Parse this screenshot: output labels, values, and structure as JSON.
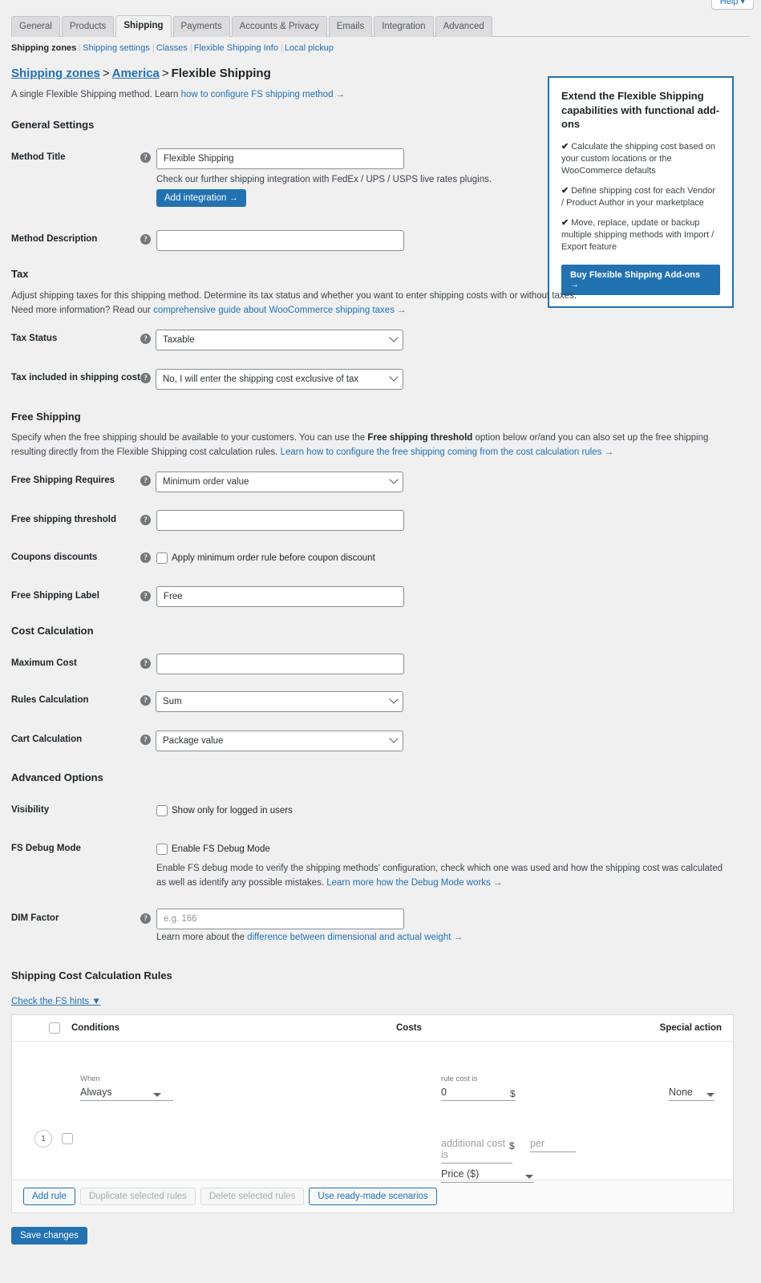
{
  "help": {
    "label": "Help ▾"
  },
  "tabs": [
    {
      "label": "General",
      "active": false
    },
    {
      "label": "Products",
      "active": false
    },
    {
      "label": "Shipping",
      "active": true
    },
    {
      "label": "Payments",
      "active": false
    },
    {
      "label": "Accounts & Privacy",
      "active": false
    },
    {
      "label": "Emails",
      "active": false
    },
    {
      "label": "Integration",
      "active": false
    },
    {
      "label": "Advanced",
      "active": false
    }
  ],
  "subnav": {
    "current": "Shipping zones",
    "links": [
      "Shipping settings",
      "Classes",
      "Flexible Shipping Info",
      "Local pickup"
    ]
  },
  "breadcrumb": {
    "root": "Shipping zones",
    "zone": "America",
    "current": "Flexible Shipping",
    "separator": ">"
  },
  "lead": {
    "text": "A single Flexible Shipping method. Learn ",
    "link": "how to configure FS shipping method →"
  },
  "promo": {
    "title": "Extend the Flexible Shipping capabilities with functional add-ons",
    "check": "✔",
    "bullets": [
      "Calculate the shipping cost based on your custom locations or the WooCommerce defaults",
      "Define shipping cost for each Vendor / Product Author in your marketplace",
      "Move, replace, update or backup multiple shipping methods with Import / Export feature"
    ],
    "cta": "Buy Flexible Shipping Add-ons →",
    "accent": "#2271b1"
  },
  "general": {
    "heading": "General Settings",
    "method_title": {
      "label": "Method Title",
      "value": "Flexible Shipping",
      "hint": "Check our further shipping integration with FedEx / UPS / USPS live rates plugins.",
      "button": "Add integration →"
    },
    "method_description": {
      "label": "Method Description",
      "value": "",
      "placeholder": ""
    }
  },
  "tax": {
    "heading": "Tax",
    "desc_1": "Adjust shipping taxes for this shipping method. Determine its tax status and whether you want to enter shipping costs with or without taxes.",
    "desc_2": "Need more information? Read our ",
    "desc_link": "comprehensive guide about WooCommerce shipping taxes →",
    "status": {
      "label": "Tax Status",
      "value": "Taxable"
    },
    "included": {
      "label": "Tax included in shipping cost",
      "value": "No, I will enter the shipping cost exclusive of tax"
    }
  },
  "free_shipping": {
    "heading": "Free Shipping",
    "desc_a": "Specify when the free shipping should be available to your customers. You can use the ",
    "desc_bold": "Free shipping threshold",
    "desc_b": " option below or/and you can also set up the free shipping resulting directly from the Flexible Shipping cost calculation rules. ",
    "desc_link": "Learn how to configure the free shipping coming from the cost calculation rules →",
    "requires": {
      "label": "Free Shipping Requires",
      "value": "Minimum order value"
    },
    "threshold": {
      "label": "Free shipping threshold",
      "value": ""
    },
    "coupons": {
      "label": "Coupons discounts",
      "checkbox_label": "Apply minimum order rule before coupon discount",
      "checked": false
    },
    "free_label": {
      "label": "Free Shipping Label",
      "value": "Free"
    }
  },
  "cost_calculation": {
    "heading": "Cost Calculation",
    "maximum_cost": {
      "label": "Maximum Cost",
      "value": ""
    },
    "rules_calculation": {
      "label": "Rules Calculation",
      "value": "Sum"
    },
    "cart_calculation": {
      "label": "Cart Calculation",
      "value": "Package value"
    }
  },
  "advanced": {
    "heading": "Advanced Options",
    "visibility": {
      "label": "Visibility",
      "checkbox_label": "Show only for logged in users",
      "checked": false
    },
    "debug": {
      "label": "FS Debug Mode",
      "checkbox_label": "Enable FS Debug Mode",
      "checked": false,
      "hint_a": "Enable FS debug mode to verify the shipping methods' configuration, check which one was used and how the shipping cost was calculated as well as identify any possible mistakes. ",
      "hint_link": "Learn more how the Debug Mode works →"
    },
    "dim_factor": {
      "label": "DIM Factor",
      "value": "",
      "placeholder": "e.g. 166",
      "hint_a": "Learn more about the ",
      "hint_link": "difference between dimensional and actual weight →"
    }
  },
  "rules": {
    "heading": "Shipping Cost Calculation Rules",
    "hints_link": "Check the FS hints ▼",
    "columns": {
      "conditions": "Conditions",
      "costs": "Costs",
      "special_action": "Special action"
    },
    "row": {
      "number": "1",
      "when_label": "When",
      "when_value": "Always",
      "rule_cost_label": "rule cost is",
      "rule_cost_value": "0",
      "currency": "$",
      "additional_cost_placeholder": "additional cost is",
      "per_label": "per",
      "per_value": "",
      "per_unit": "Price ($)",
      "special_action_value": "None"
    },
    "buttons": [
      {
        "label": "Add rule",
        "disabled": false
      },
      {
        "label": "Duplicate selected rules",
        "disabled": true
      },
      {
        "label": "Delete selected rules",
        "disabled": true
      },
      {
        "label": "Use ready-made scenarios",
        "disabled": false
      }
    ]
  },
  "save": {
    "label": "Save changes"
  }
}
